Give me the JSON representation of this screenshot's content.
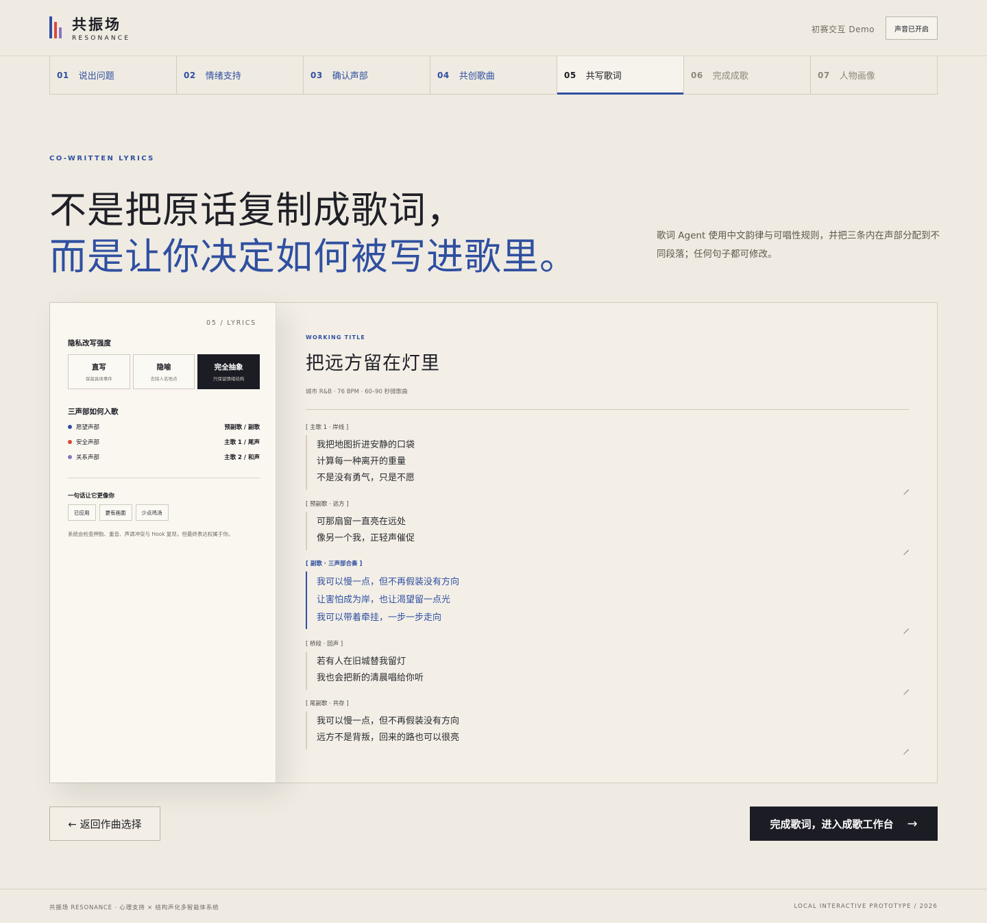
{
  "brand": {
    "name": "共振场",
    "subtitle": "RESONANCE",
    "bar_colors": [
      "#2f4fa0",
      "#d94a3a",
      "#8b74c0"
    ]
  },
  "header": {
    "demo_label": "初赛交互 Demo",
    "sound_button": "声音已开启"
  },
  "steps": [
    {
      "num": "01",
      "label": "说出问题",
      "state": "done"
    },
    {
      "num": "02",
      "label": "情绪支持",
      "state": "done"
    },
    {
      "num": "03",
      "label": "确认声部",
      "state": "done"
    },
    {
      "num": "04",
      "label": "共创歌曲",
      "state": "done"
    },
    {
      "num": "05",
      "label": "共写歌词",
      "state": "active"
    },
    {
      "num": "06",
      "label": "完成成歌",
      "state": "todo"
    },
    {
      "num": "07",
      "label": "人物画像",
      "state": "todo"
    }
  ],
  "hero": {
    "eyebrow": "CO-WRITTEN LYRICS",
    "line1": "不是把原话复制成歌词，",
    "line2": "而是让你决定如何被写进歌里。",
    "description": "歌词 Agent 使用中文韵律与可唱性规则，并把三条内在声部分配到不同段落；任何句子都可修改。"
  },
  "panel": {
    "tag": "05 / LYRICS",
    "privacy_heading": "隐私改写强度",
    "privacy_options": [
      {
        "title": "直写",
        "sub": "保留具体事件",
        "selected": false
      },
      {
        "title": "隐喻",
        "sub": "去除人名地点",
        "selected": false
      },
      {
        "title": "完全抽象",
        "sub": "只保留情绪结构",
        "selected": true
      }
    ],
    "voices_heading": "三声部如何入歌",
    "voices": [
      {
        "name": "愿望声部",
        "placement": "预副歌 / 副歌",
        "color": "#2f4fa0"
      },
      {
        "name": "安全声部",
        "placement": "主歌 1 / 尾声",
        "color": "#d94a3a"
      },
      {
        "name": "关系声部",
        "placement": "主歌 2 / 和声",
        "color": "#8b74c0"
      }
    ],
    "tweak_heading": "一句话让它更像你",
    "chips": [
      "已应用",
      "更有画面",
      "少点鸡汤"
    ],
    "note": "系统会检查押韵、重音、声调冲突与 Hook 复现，但最终表达权属于你。"
  },
  "lyrics": {
    "working_title_label": "WORKING TITLE",
    "title": "把远方留在灯里",
    "meta": "城市 R&B · 76 BPM · 60–90 秒微歌曲",
    "sections": [
      {
        "label": "[ 主歌 1 · 岸线 ]",
        "lines": [
          "我把地图折进安静的口袋",
          "计算每一种离开的重量",
          "不是没有勇气，只是不愿"
        ],
        "chorus": false
      },
      {
        "label": "[ 预副歌 · 远方 ]",
        "lines": [
          "可那扇窗一直亮在远处",
          "像另一个我，正轻声催促"
        ],
        "chorus": false
      },
      {
        "label": "[ 副歌 · 三声部合奏 ]",
        "lines": [
          "我可以慢一点，但不再假装没有方向",
          "让害怕成为岸，也让渴望留一点光",
          "我可以带着牵挂，一步一步走向"
        ],
        "chorus": true
      },
      {
        "label": "[ 桥段 · 回声 ]",
        "lines": [
          "若有人在旧城替我留灯",
          "我也会把新的清晨唱给你听"
        ],
        "chorus": false
      },
      {
        "label": "[ 尾副歌 · 共存 ]",
        "lines": [
          "我可以慢一点，但不再假装没有方向",
          "远方不是背叛，回来的路也可以很亮"
        ],
        "chorus": false
      }
    ]
  },
  "actions": {
    "back": "← 返回作曲选择",
    "next": "完成歌词，进入成歌工作台",
    "next_arrow": "→"
  },
  "footer": {
    "left": "共振场 RESONANCE · 心理支持 × 结构声化多智能体系统",
    "right": "LOCAL INTERACTIVE PROTOTYPE / 2026"
  }
}
